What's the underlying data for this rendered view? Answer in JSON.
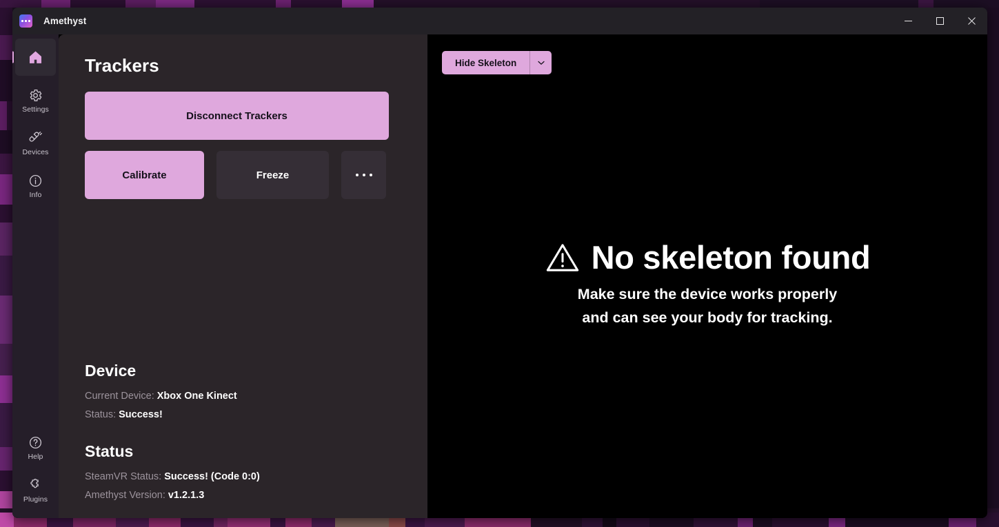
{
  "window": {
    "app_title": "Amethyst",
    "logo_icon": "amethyst-dots-logo",
    "controls": {
      "minimize": "minimize-icon",
      "maximize": "maximize-icon",
      "close": "close-icon"
    }
  },
  "sidebar": {
    "items": [
      {
        "label": "",
        "icon": "home-icon",
        "selected": true
      },
      {
        "label": "Settings",
        "icon": "gear-icon",
        "selected": false
      },
      {
        "label": "Devices",
        "icon": "devices-plug-icon",
        "selected": false
      },
      {
        "label": "Info",
        "icon": "info-circle-icon",
        "selected": false
      }
    ],
    "bottom_items": [
      {
        "label": "Help",
        "icon": "question-circle-icon"
      },
      {
        "label": "Plugins",
        "icon": "puzzle-piece-icon"
      }
    ]
  },
  "trackers": {
    "title": "Trackers",
    "disconnect_label": "Disconnect Trackers",
    "calibrate_label": "Calibrate",
    "freeze_label": "Freeze",
    "more_label": "More options",
    "more_icon": "ellipsis-icon"
  },
  "device": {
    "title": "Device",
    "current_device_key": "Current Device:",
    "current_device_value": "Xbox One Kinect",
    "status_key": "Status:",
    "status_value": "Success!"
  },
  "status": {
    "title": "Status",
    "steamvr_key": "SteamVR Status:",
    "steamvr_value": "Success! (Code 0:0)",
    "version_key": "Amethyst Version:",
    "version_value": "v1.2.1.3"
  },
  "preview": {
    "hide_skeleton_label": "Hide Skeleton",
    "dropdown_icon": "chevron-down-icon",
    "empty_icon": "warning-triangle-icon",
    "empty_title": "No skeleton found",
    "empty_line1": "Make sure the device works properly",
    "empty_line2": "and can see your body for tracking."
  },
  "colors": {
    "accent": "#dfa8dd",
    "sidebar_bg": "#251e29",
    "content_bg": "#2b2529",
    "preview_bg": "#000000",
    "titlebar_bg": "#232126",
    "neutral_button": "#352e36"
  }
}
